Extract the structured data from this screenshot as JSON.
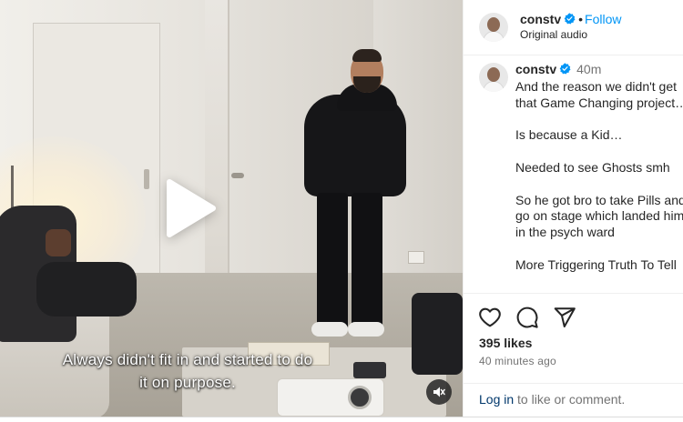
{
  "video": {
    "subtitle_line1": "Always didn't fit in and started to do",
    "subtitle_line2": "it on purpose.",
    "play_icon": "play-icon",
    "mute_icon": "speaker-muted-icon"
  },
  "header": {
    "username": "constv",
    "separator": "•",
    "follow_label": "Follow",
    "audio_label": "Original audio",
    "verified_icon": "verified-badge-icon"
  },
  "comment": {
    "username": "constv",
    "time_ago": "40m",
    "text": "And the reason we didn't get that Game Changing project…\n\nIs because a Kid…\n\nNeeded to see Ghosts smh\n\nSo he got bro to take Pills and go on stage which landed him in the psych ward\n\nMore Triggering Truth To Tell"
  },
  "actions": {
    "like_icon": "heart-icon",
    "comment_icon": "comment-bubble-icon",
    "share_icon": "paper-plane-icon",
    "likes": "395 likes",
    "posted": "40 minutes ago",
    "login_link": "Log in",
    "login_suffix": " to like or comment."
  },
  "colors": {
    "link_blue": "#0095f6",
    "verified_blue": "#0095f6",
    "login_link": "#00376b",
    "secondary_text": "#737373"
  }
}
